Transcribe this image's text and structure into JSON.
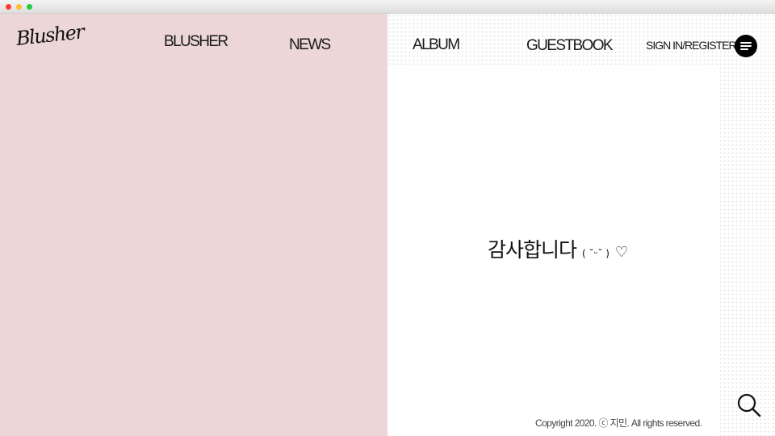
{
  "header": {
    "logo": "Blusher",
    "nav": {
      "blusher": "BLUSHER",
      "news": "NEWS",
      "album": "ALBUM",
      "guestbook": "GUESTBOOK",
      "signin": "SIGN IN/REGISTER"
    },
    "menu_icon": "hamburger-icon"
  },
  "main": {
    "message": "감사합니다",
    "emoticon": "( ˘ᵕ˘ )",
    "heart": "♡"
  },
  "footer": {
    "copyright": "Copyright 2020. ⓒ 지민. All rights reserved."
  },
  "search_icon": "search-icon",
  "colors": {
    "left_panel": "#ecd6d7",
    "right_panel": "#ffffff",
    "text": "#111111"
  }
}
